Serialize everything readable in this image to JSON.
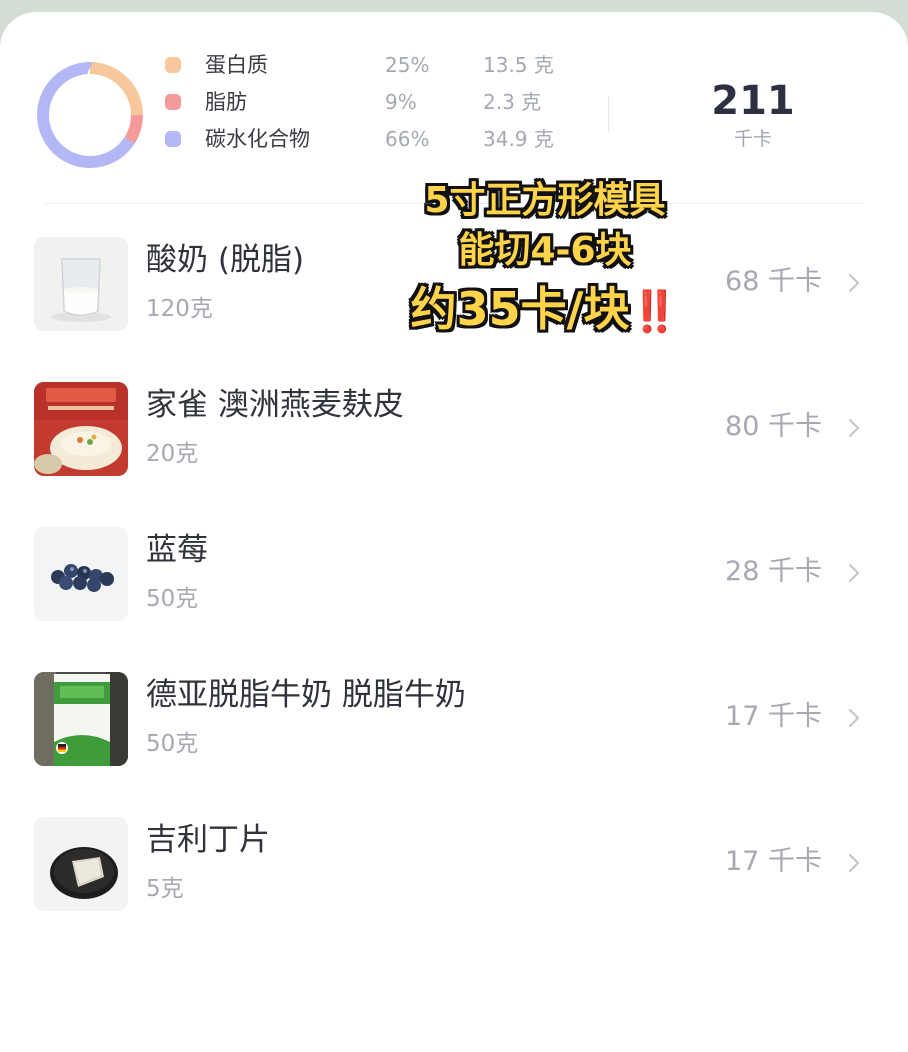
{
  "summary": {
    "macros": [
      {
        "name": "蛋白质",
        "percent": "25%",
        "grams": "13.5 克",
        "color": "#f8c79b",
        "share": 0.25
      },
      {
        "name": "脂肪",
        "percent": "9%",
        "grams": "2.3 克",
        "color": "#f49a9a",
        "share": 0.09
      },
      {
        "name": "碳水化合物",
        "percent": "66%",
        "grams": "34.9 克",
        "color": "#b4b7f5",
        "share": 0.66
      }
    ],
    "total_kcal": "211",
    "kcal_unit": "千卡"
  },
  "overlay": {
    "line1": "5寸正方形模具",
    "line2": "能切4-6块",
    "line3": "约35卡/块",
    "emoji": "‼️"
  },
  "foods": [
    {
      "name": "酸奶 (脱脂)",
      "amount": "120克",
      "kcal": "68 千卡",
      "thumb_icon": "yogurt-glass-icon"
    },
    {
      "name": "家雀 澳洲燕麦麸皮",
      "amount": "20克",
      "kcal": "80 千卡",
      "thumb_icon": "oat-bran-package-icon"
    },
    {
      "name": "蓝莓",
      "amount": "50克",
      "kcal": "28 千卡",
      "thumb_icon": "blueberries-icon"
    },
    {
      "name": "德亚脱脂牛奶 脱脂牛奶",
      "amount": "50克",
      "kcal": "17 千卡",
      "thumb_icon": "milk-carton-icon"
    },
    {
      "name": "吉利丁片",
      "amount": "5克",
      "kcal": "17 千卡",
      "thumb_icon": "gelatin-sheet-icon"
    }
  ]
}
